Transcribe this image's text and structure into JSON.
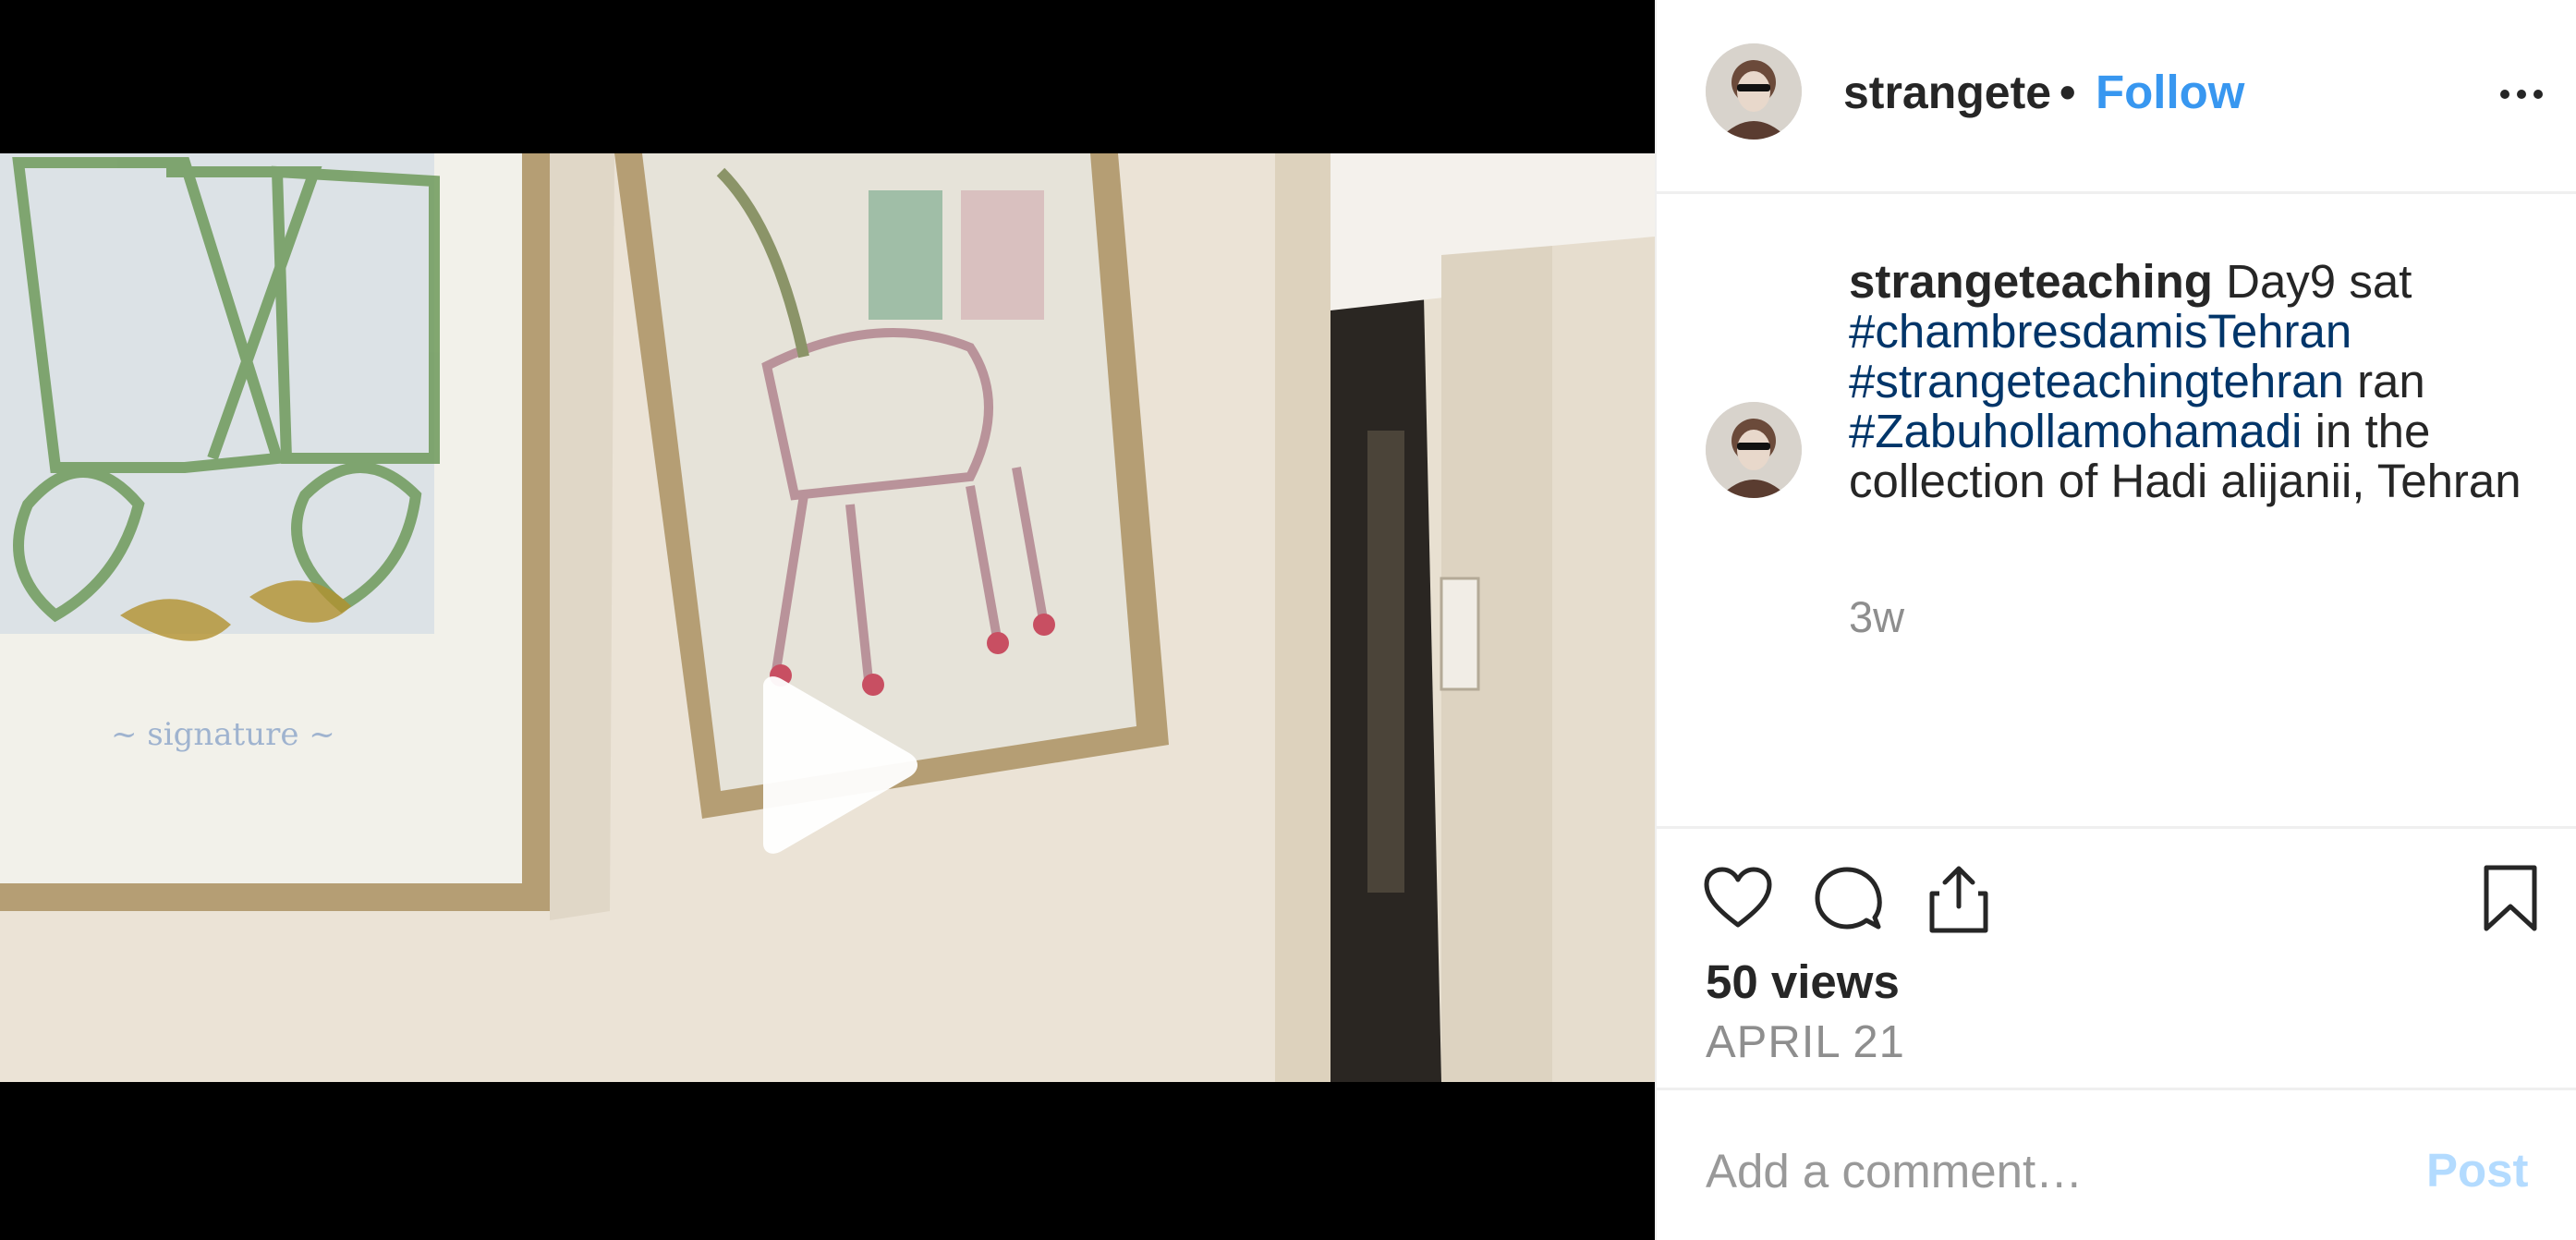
{
  "post": {
    "username": "strangeteaching",
    "header_username": "strangeteaching",
    "separator": "•",
    "follow_label": "Follow",
    "more_icon": "more-horizontal-icon",
    "play_icon": "play-icon"
  },
  "caption": {
    "username": "strangeteaching",
    "text_1": " Day9 sat ",
    "tag_1": "#chambresdamisTehran",
    "text_2": " ",
    "tag_2": "#strangeteachingtehran",
    "text_3": " ran ",
    "tag_3": "#Zabuhollamohamadi",
    "text_4": " in the collection of Hadi alijanii, Tehran",
    "age": "3w"
  },
  "actions": {
    "icons": [
      "heart-icon",
      "comment-icon",
      "share-icon",
      "bookmark-icon"
    ]
  },
  "stats": {
    "views": "50 views",
    "date": "APRIL 21"
  },
  "comment": {
    "placeholder": "Add a comment…",
    "post_label": "Post"
  },
  "colors": {
    "link_blue": "#3897f0",
    "hashtag_blue": "#003569",
    "muted_gray": "#8e8e8e",
    "post_disabled": "#b3dbff",
    "video_letterbox": "#000000"
  }
}
